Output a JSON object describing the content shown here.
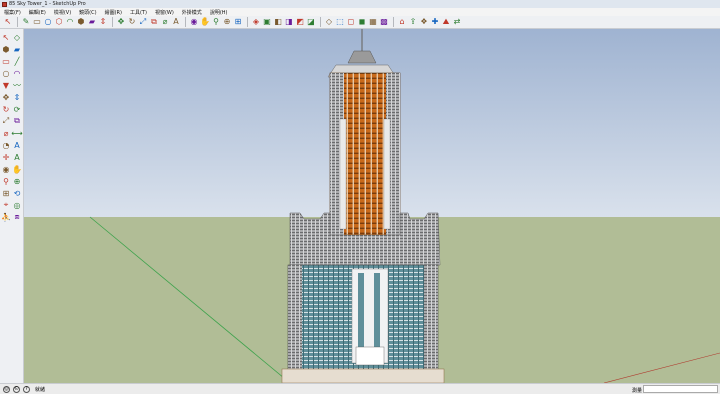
{
  "window": {
    "title": "85 Sky Tower_1 - SketchUp Pro"
  },
  "menu": [
    "檔案(F)",
    "編輯(E)",
    "檢視(V)",
    "鏡頭(C)",
    "繪圖(R)",
    "工具(T)",
    "視窗(W)",
    "外掛模式",
    "說明(H)"
  ],
  "toolbar": {
    "buttons": [
      {
        "icon": "select-arrow-icon",
        "glyph": "↖"
      },
      {
        "icon": "pencil-line-icon",
        "glyph": "✎"
      },
      {
        "icon": "rectangle-icon",
        "glyph": "▭"
      },
      {
        "icon": "circle-icon",
        "glyph": "○"
      },
      {
        "icon": "polygon-icon",
        "glyph": "⬡"
      },
      {
        "icon": "arc-icon",
        "glyph": "◠"
      },
      {
        "icon": "paint-bucket-icon",
        "glyph": "⬢"
      },
      {
        "icon": "eraser-icon",
        "glyph": "▰"
      },
      {
        "icon": "push-pull-icon",
        "glyph": "⇕"
      },
      {
        "icon": "move-icon",
        "glyph": "✥"
      },
      {
        "icon": "rotate-icon",
        "glyph": "↻"
      },
      {
        "icon": "scale-icon",
        "glyph": "⤢"
      },
      {
        "icon": "offset-icon",
        "glyph": "⧉"
      },
      {
        "icon": "tape-measure-icon",
        "glyph": "⌀"
      },
      {
        "icon": "text-icon",
        "glyph": "A"
      },
      {
        "icon": "orbit-icon",
        "glyph": "◉"
      },
      {
        "icon": "pan-icon",
        "glyph": "✋"
      },
      {
        "icon": "zoom-icon",
        "glyph": "⚲"
      },
      {
        "icon": "zoom-window-icon",
        "glyph": "⊕"
      },
      {
        "icon": "zoom-extents-icon",
        "glyph": "⊞"
      },
      {
        "icon": "iso-view-icon",
        "glyph": "◈"
      },
      {
        "icon": "top-view-icon",
        "glyph": "▣"
      },
      {
        "icon": "front-view-icon",
        "glyph": "◧"
      },
      {
        "icon": "right-view-icon",
        "glyph": "◨"
      },
      {
        "icon": "back-view-icon",
        "glyph": "◩"
      },
      {
        "icon": "left-view-icon",
        "glyph": "◪"
      },
      {
        "icon": "xray-icon",
        "glyph": "◇"
      },
      {
        "icon": "wireframe-icon",
        "glyph": "⬚"
      },
      {
        "icon": "hidden-line-icon",
        "glyph": "◻"
      },
      {
        "icon": "shaded-icon",
        "glyph": "◼"
      },
      {
        "icon": "textured-icon",
        "glyph": "▦"
      },
      {
        "icon": "monochrome-icon",
        "glyph": "▩"
      },
      {
        "icon": "warehouse-icon",
        "glyph": "⌂"
      },
      {
        "icon": "share-model-icon",
        "glyph": "⇪"
      },
      {
        "icon": "component-icon",
        "glyph": "❖"
      },
      {
        "icon": "extension-icon",
        "glyph": "✚"
      },
      {
        "icon": "sandbox-icon",
        "glyph": "⛰"
      },
      {
        "icon": "flip-icon",
        "glyph": "⇄"
      }
    ],
    "colors": [
      "#c0392b",
      "#2e7d32",
      "#7a5a2e",
      "#1565c0",
      "#c0392b",
      "#2e7d32",
      "#7a5a2e",
      "#6a1b9a"
    ]
  },
  "left_tools": [
    {
      "icon": "select-arrow-icon",
      "glyph": "↖"
    },
    {
      "icon": "make-component-icon",
      "glyph": "◇"
    },
    {
      "icon": "paint-bucket-icon",
      "glyph": "⬢"
    },
    {
      "icon": "eraser-icon",
      "glyph": "▰"
    },
    {
      "icon": "rectangle-icon",
      "glyph": "▭"
    },
    {
      "icon": "pencil-line-icon",
      "glyph": "╱"
    },
    {
      "icon": "circle-icon",
      "glyph": "○"
    },
    {
      "icon": "arc-icon",
      "glyph": "◠"
    },
    {
      "icon": "polygon-icon",
      "glyph": "▼"
    },
    {
      "icon": "freehand-icon",
      "glyph": "〰"
    },
    {
      "icon": "move-icon",
      "glyph": "✥"
    },
    {
      "icon": "push-pull-icon",
      "glyph": "⇕"
    },
    {
      "icon": "rotate-icon",
      "glyph": "↻"
    },
    {
      "icon": "follow-me-icon",
      "glyph": "⟳"
    },
    {
      "icon": "scale-icon",
      "glyph": "⤢"
    },
    {
      "icon": "offset-icon",
      "glyph": "⧉"
    },
    {
      "icon": "tape-measure-icon",
      "glyph": "⌀"
    },
    {
      "icon": "dimension-icon",
      "glyph": "⟷"
    },
    {
      "icon": "protractor-icon",
      "glyph": "◔"
    },
    {
      "icon": "text-icon",
      "glyph": "A"
    },
    {
      "icon": "axes-icon",
      "glyph": "✛"
    },
    {
      "icon": "3d-text-icon",
      "glyph": "A"
    },
    {
      "icon": "orbit-icon",
      "glyph": "◉"
    },
    {
      "icon": "pan-icon",
      "glyph": "✋"
    },
    {
      "icon": "zoom-icon",
      "glyph": "⚲"
    },
    {
      "icon": "zoom-window-icon",
      "glyph": "⊕"
    },
    {
      "icon": "zoom-extents-icon",
      "glyph": "⊞"
    },
    {
      "icon": "previous-view-icon",
      "glyph": "⟲"
    },
    {
      "icon": "position-camera-icon",
      "glyph": "⌖"
    },
    {
      "icon": "look-around-icon",
      "glyph": "◎"
    },
    {
      "icon": "walk-icon",
      "glyph": "⛹"
    },
    {
      "icon": "section-plane-icon",
      "glyph": "⧈"
    }
  ],
  "status": {
    "text": "就緒",
    "measure_label": "測量",
    "measure_value": ""
  },
  "scene": {
    "sky_top": "#9fb3d1",
    "sky_bottom": "#d9e1ec",
    "ground": "#b1bd96",
    "tower_orange": "#c96a1b",
    "tower_grey": "#8c8c8c",
    "base_teal": "#5f8f9a"
  }
}
